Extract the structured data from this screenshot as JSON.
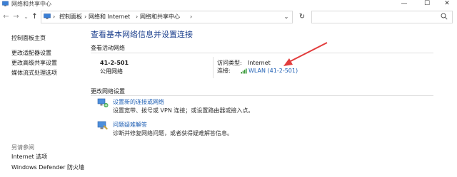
{
  "window": {
    "title": "网络和共享中心"
  },
  "controls": {
    "minimize": "—",
    "maximize": "☐",
    "close": "✕"
  },
  "nav": {
    "back": "←",
    "forward": "→",
    "recent": "⌄",
    "up": "↑",
    "breadcrumbs": [
      "控制面板",
      "网络和 Internet",
      "网络和共享中心"
    ],
    "separator": "›",
    "dropdown": "⌄",
    "refresh": "↻"
  },
  "sidebar": {
    "items": [
      {
        "label": "控制面板主页"
      },
      {
        "label": "更改适配器设置"
      },
      {
        "label": "更改高级共享设置"
      },
      {
        "label": "媒体流式处理选项"
      }
    ],
    "see_also": {
      "heading": "另请参阅",
      "items": [
        {
          "label": "Internet 选项"
        },
        {
          "label": "Windows Defender 防火墙"
        }
      ]
    }
  },
  "main": {
    "title": "查看基本网络信息并设置连接",
    "active_networks": {
      "heading": "查看活动网络",
      "network_name": "41-2-501",
      "network_type": "公用网络",
      "access_type_label": "访问类型:",
      "access_type_value": "Internet",
      "connection_label": "连接:",
      "connection_value": "WLAN (41-2-501)"
    },
    "change_settings": {
      "heading": "更改网络设置",
      "items": [
        {
          "title": "设置新的连接或网络",
          "description": "设置宽带、拨号或 VPN 连接；或设置路由器或接入点。"
        },
        {
          "title": "问题疑难解答",
          "description": "诊断并修复网络问题，或者获得疑难解答信息。"
        }
      ]
    }
  },
  "colors": {
    "link": "#1e5fb4",
    "title": "#1a3e8c",
    "annotation_arrow": "#e23c3c"
  }
}
